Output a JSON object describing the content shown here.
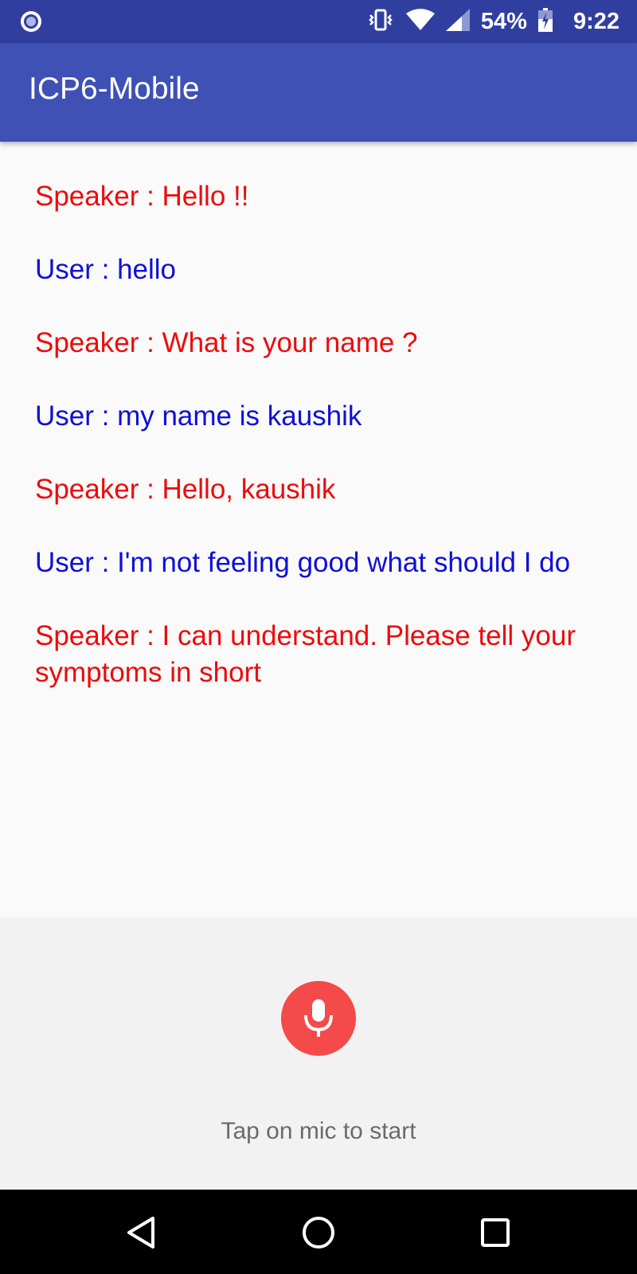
{
  "status_bar": {
    "left_icon": "notification-dot-icon",
    "icons": [
      "vibrate-icon",
      "wifi-icon",
      "signal-icon",
      "battery-icon"
    ],
    "battery_percent": "54%",
    "time": "9:22"
  },
  "app_bar": {
    "title": "ICP6-Mobile"
  },
  "conversation": {
    "messages": [
      {
        "role": "speaker",
        "text": "Speaker : Hello !!"
      },
      {
        "role": "user",
        "text": "User : hello"
      },
      {
        "role": "speaker",
        "text": "Speaker : What is your name ?"
      },
      {
        "role": "user",
        "text": "User : my name is kaushik"
      },
      {
        "role": "speaker",
        "text": "Speaker : Hello, kaushik"
      },
      {
        "role": "user",
        "text": "User : I'm not feeling good what should I do"
      },
      {
        "role": "speaker",
        "text": "Speaker : I can understand. Please tell your symptoms in short"
      }
    ]
  },
  "mic_panel": {
    "icon": "microphone-icon",
    "hint": "Tap on mic to start"
  },
  "nav_bar": {
    "icons": [
      "back-icon",
      "home-icon",
      "recents-icon"
    ]
  },
  "colors": {
    "status_bar": "#303f9f",
    "app_bar": "#3f51b5",
    "speaker_text": "#ec0b0b",
    "user_text": "#0f0fd8",
    "mic_button": "#f44a4a",
    "nav_bar": "#000000"
  }
}
